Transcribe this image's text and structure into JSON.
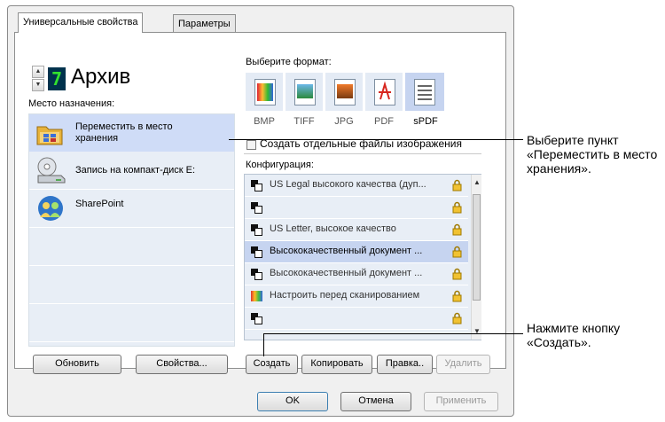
{
  "tabs": [
    "Универсальные свойства",
    "Параметры"
  ],
  "profile": {
    "number": "7",
    "name": "Архив"
  },
  "destination": {
    "label": "Место назначения:",
    "items": [
      {
        "line1": "Переместить в место",
        "line2": "хранения",
        "icon": "folder-move-icon",
        "selected": true
      },
      {
        "line1": "Запись на компакт-диск  E:",
        "line2": "",
        "icon": "cd-drive-icon",
        "selected": false
      },
      {
        "line1": "SharePoint",
        "line2": "",
        "icon": "sharepoint-icon",
        "selected": false
      }
    ],
    "refresh_button": "Обновить",
    "properties_button": "Свойства..."
  },
  "format": {
    "label": "Выберите формат:",
    "items": [
      {
        "name": "BMP",
        "selected": false
      },
      {
        "name": "TIFF",
        "selected": false
      },
      {
        "name": "JPG",
        "selected": false
      },
      {
        "name": "PDF",
        "selected": false
      },
      {
        "name": "sPDF",
        "selected": true
      }
    ],
    "separate_files_checkbox": "Создать отдельные файлы изображения"
  },
  "config": {
    "label": "Конфигурация:",
    "items": [
      {
        "text": "US Legal высокого качества (дуп...",
        "selected": false
      },
      {
        "text": "",
        "selected": false
      },
      {
        "text": "US Letter, высокое качество",
        "selected": false
      },
      {
        "text": "Высококачественный документ ...",
        "selected": true
      },
      {
        "text": "Высококачественный документ ...",
        "selected": false
      },
      {
        "text": "Настроить перед сканированием",
        "selected": false
      },
      {
        "text": "",
        "selected": false
      }
    ],
    "buttons": {
      "create": "Создать",
      "copy": "Копировать",
      "edit": "Правка..",
      "delete": "Удалить"
    }
  },
  "footer": {
    "ok": "OK",
    "cancel": "Отмена",
    "apply": "Применить"
  },
  "callouts": {
    "select_item": "Выберите пункт «Переместить в место хранения».",
    "press_create": "Нажмите кнопку «Создать»."
  },
  "colors": {
    "selected_row": "#cfdcf7",
    "list_background": "#e8eef6",
    "digit": "#32e12e"
  }
}
